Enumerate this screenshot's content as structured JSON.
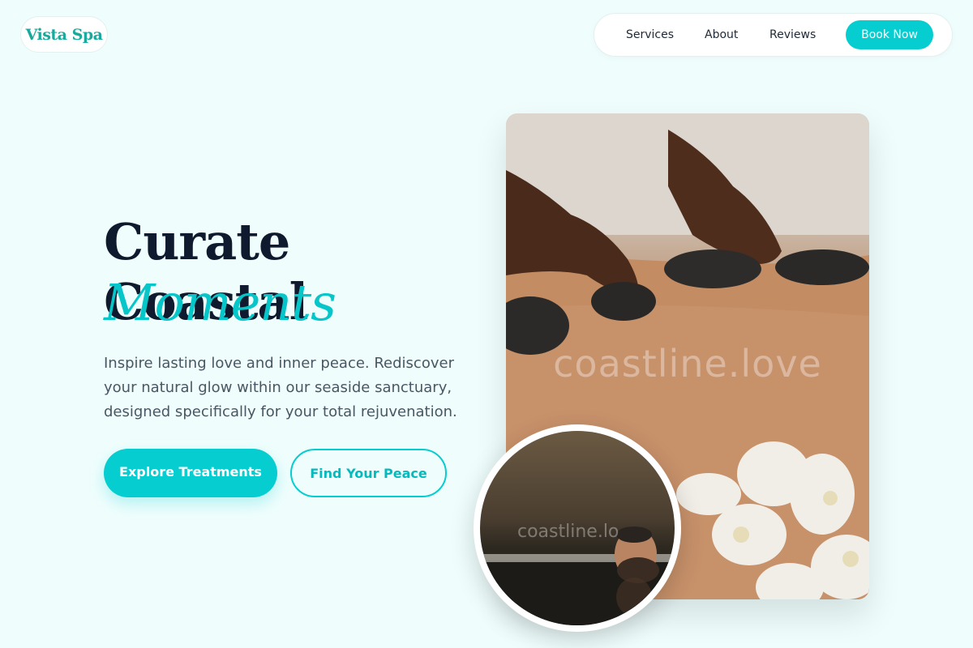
{
  "brand": {
    "logo": "Vista Spa"
  },
  "nav": {
    "items": [
      "Services",
      "About",
      "Reviews"
    ],
    "cta": "Book Now"
  },
  "hero": {
    "headline": "Curate Coastal",
    "headline_accent": "Moments",
    "subtitle": "Inspire lasting love and inner peace. Rediscover your natural glow within our seaside sanctuary, designed specifically for your total rejuvenation.",
    "primary_button": "Explore Treatments",
    "secondary_button": "Find Your Peace"
  },
  "images": {
    "main_watermark": "coastline.love",
    "inset_watermark": "coastline.lo"
  },
  "colors": {
    "accent": "#06cdd0",
    "background": "#effefd",
    "heading": "#101a2e",
    "logo": "#1aa99c"
  }
}
